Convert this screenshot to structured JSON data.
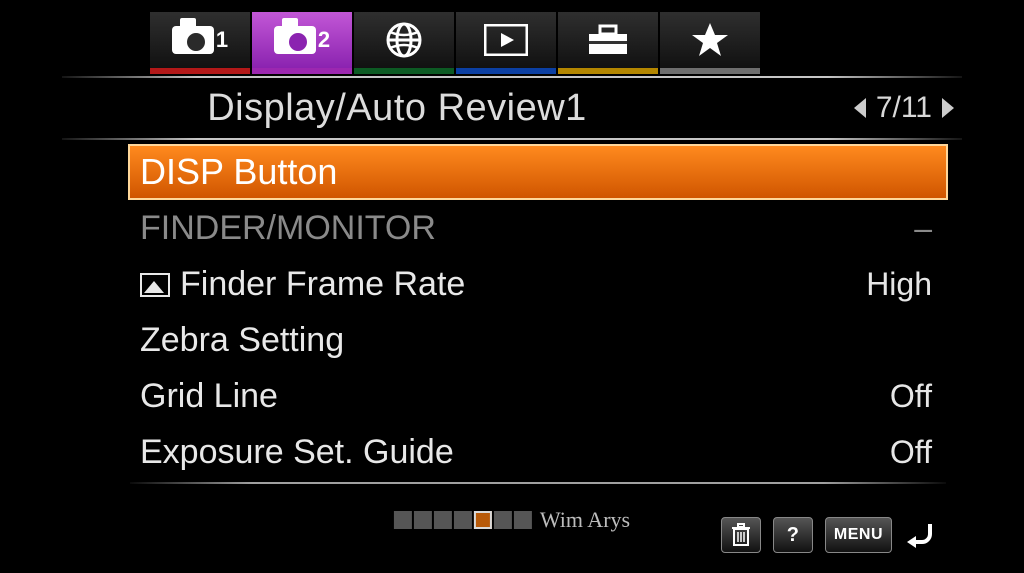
{
  "tabs": [
    {
      "id": "camera1",
      "num": "1",
      "underline": "#b31818"
    },
    {
      "id": "camera2",
      "num": "2",
      "underline": "#9c27b0",
      "active": true
    },
    {
      "id": "network",
      "underline": "#0c5a23"
    },
    {
      "id": "playback",
      "underline": "#0b3fa3"
    },
    {
      "id": "setup",
      "underline": "#b38600"
    },
    {
      "id": "favorites",
      "underline": "#6e6e6e"
    }
  ],
  "header": {
    "title": "Display/Auto Review1",
    "pager": "7/11"
  },
  "rows": [
    {
      "label": "DISP Button",
      "value": "",
      "state": "selected"
    },
    {
      "label": "FINDER/MONITOR",
      "value": "–",
      "state": "disabled"
    },
    {
      "label": "Finder Frame Rate",
      "value": "High",
      "icon": "picture"
    },
    {
      "label": "Zebra Setting",
      "value": ""
    },
    {
      "label": "Grid Line",
      "value": "Off"
    },
    {
      "label": "Exposure Set. Guide",
      "value": "Off"
    }
  ],
  "footer": {
    "trash": "🗑",
    "help": "?",
    "menu": "MENU"
  },
  "watermark": "Wim Arys"
}
